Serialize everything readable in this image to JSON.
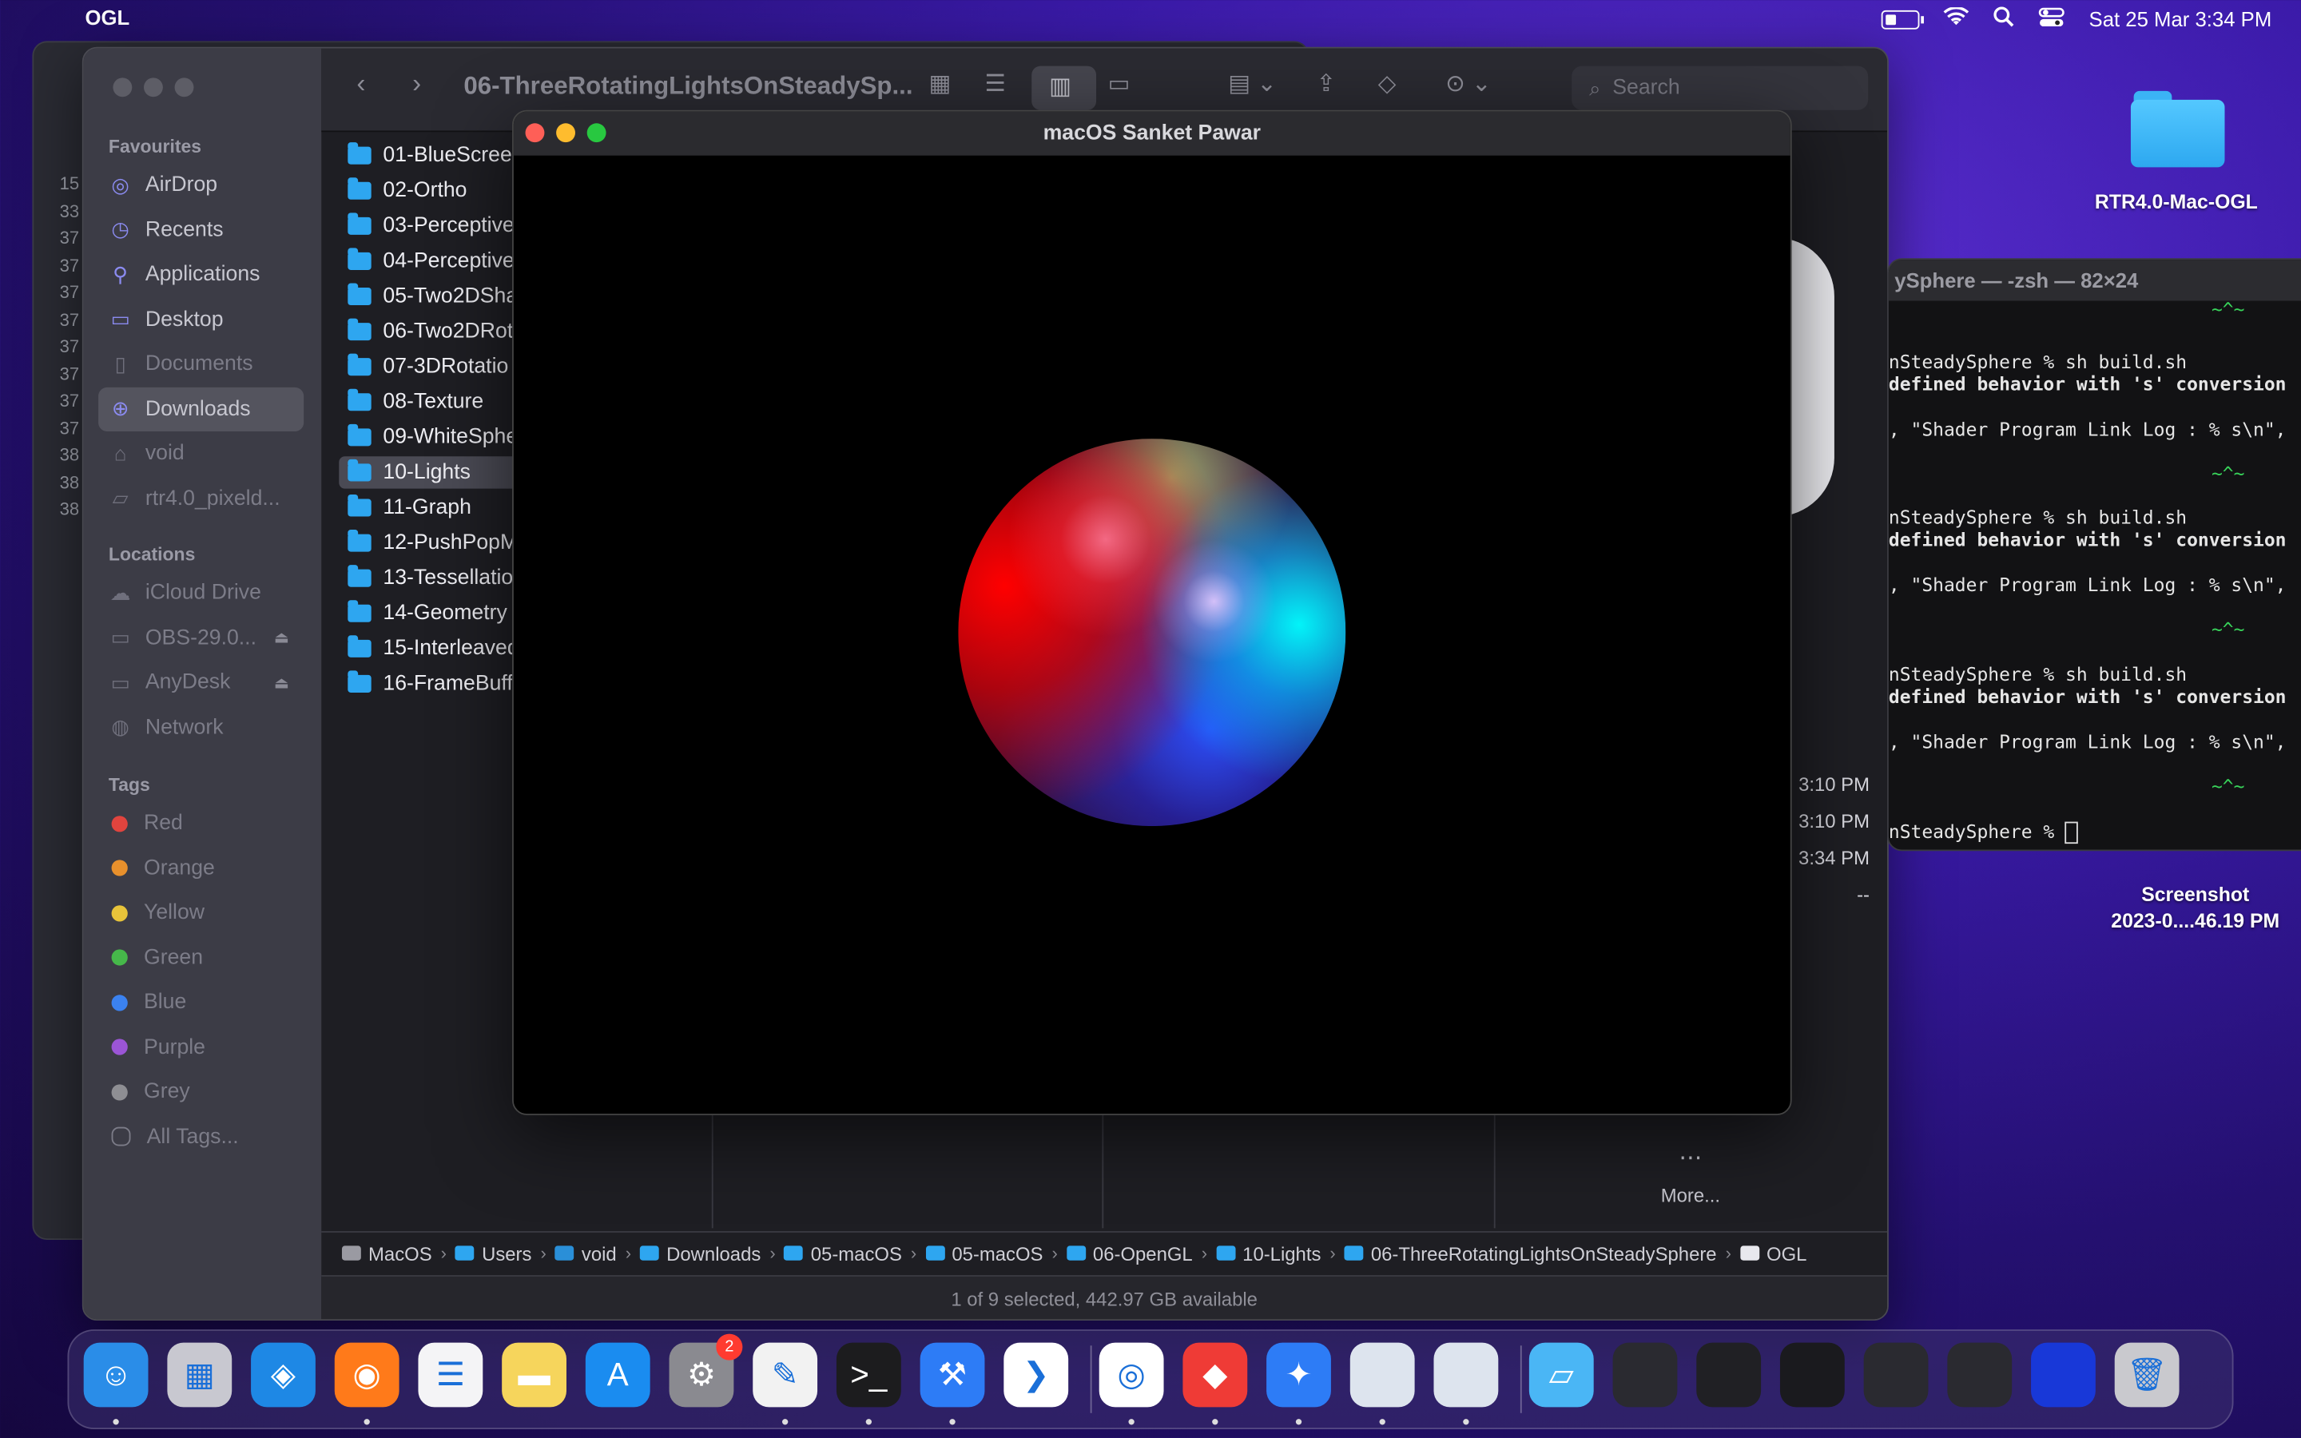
{
  "menubar": {
    "app_name": "OGL",
    "datetime": "Sat 25 Mar  3:34 PM"
  },
  "finder": {
    "title": "06-ThreeRotatingLightsOnSteadySp...",
    "search_placeholder": "Search",
    "sections": {
      "favourites": "Favourites",
      "locations": "Locations",
      "tags": "Tags"
    },
    "favourites": [
      {
        "label": "AirDrop",
        "icon": "airdrop-icon"
      },
      {
        "label": "Recents",
        "icon": "clock-icon"
      },
      {
        "label": "Applications",
        "icon": "applications-icon"
      },
      {
        "label": "Desktop",
        "icon": "desktop-icon"
      },
      {
        "label": "Documents",
        "icon": "document-icon"
      },
      {
        "label": "Downloads",
        "icon": "download-icon"
      },
      {
        "label": "void",
        "icon": "home-icon"
      },
      {
        "label": "rtr4.0_pixeld...",
        "icon": "folder-icon"
      }
    ],
    "locations": [
      {
        "label": "iCloud Drive",
        "icon": "cloud-icon"
      },
      {
        "label": "OBS-29.0...",
        "icon": "disk-icon"
      },
      {
        "label": "AnyDesk",
        "icon": "disk-icon"
      },
      {
        "label": "Network",
        "icon": "network-icon"
      }
    ],
    "tags": [
      {
        "label": "Red",
        "color": "#e0443e"
      },
      {
        "label": "Orange",
        "color": "#e8902c"
      },
      {
        "label": "Yellow",
        "color": "#e8c43a"
      },
      {
        "label": "Green",
        "color": "#46b84a"
      },
      {
        "label": "Blue",
        "color": "#3b82f0"
      },
      {
        "label": "Purple",
        "color": "#9b55d6"
      },
      {
        "label": "Grey",
        "color": "#8e8e93"
      },
      {
        "label": "All Tags...",
        "color": ""
      }
    ],
    "folders": [
      "01-BlueScree",
      "02-Ortho",
      "03-Perceptive",
      "04-Perceptive",
      "05-Two2DSha",
      "06-Two2DRot",
      "07-3DRotatio",
      "08-Texture",
      "09-WhiteSphe",
      "10-Lights",
      "11-Graph",
      "12-PushPopM",
      "13-Tessellatio",
      "14-Geometry",
      "15-Interleaved",
      "16-FrameBuff"
    ],
    "selected_folder": "10-Lights",
    "times": [
      ", 3:10 PM",
      ", 3:10 PM",
      "3:34 PM",
      "--"
    ],
    "more_label": "More...",
    "path": [
      "MacOS",
      "Users",
      "void",
      "Downloads",
      "05-macOS",
      "05-macOS",
      "06-OpenGL",
      "10-Lights",
      "06-ThreeRotatingLightsOnSteadySphere",
      "OGL"
    ],
    "status": "1 of 9 selected, 442.97 GB available"
  },
  "gl_window": {
    "title": "macOS Sanket Pawar"
  },
  "terminal": {
    "title": "ySphere — -zsh — 82×24",
    "lines": [
      {
        "text": "~^~",
        "style": "g"
      },
      {
        "text": "nSteadySphere % sh build.sh",
        "style": ""
      },
      {
        "text": "defined behavior with 's' conversion",
        "style": "b"
      },
      {
        "text": ", \"Shader Program Link Log : % s\\n\",",
        "style": ""
      },
      {
        "text": "~^~",
        "style": "g"
      },
      {
        "text": "nSteadySphere % sh build.sh",
        "style": ""
      },
      {
        "text": "defined behavior with 's' conversion",
        "style": "b"
      },
      {
        "text": ", \"Shader Program Link Log : % s\\n\",",
        "style": ""
      },
      {
        "text": "~^~",
        "style": "g"
      },
      {
        "text": "nSteadySphere % sh build.sh",
        "style": ""
      },
      {
        "text": "defined behavior with 's' conversion",
        "style": "b"
      },
      {
        "text": ", \"Shader Program Link Log : % s\\n\",",
        "style": ""
      },
      {
        "text": "~^~",
        "style": "g"
      },
      {
        "text": "nSteadySphere % ",
        "style": ""
      }
    ]
  },
  "desktop": {
    "folder_label": "RTR4.0-Mac-OGL",
    "screenshot_label_1": "Screenshot",
    "screenshot_label_2": "2023-0....46.19 PM"
  },
  "bg_line_numbers": [
    "15",
    "33",
    "37",
    "37",
    "37",
    "37",
    "37",
    "37",
    "37",
    "37",
    "38",
    "38",
    "38"
  ],
  "dock": {
    "apps": [
      {
        "name": "finder",
        "icon": "finder-icon",
        "color": "#2a8de8",
        "running": true
      },
      {
        "name": "launchpad",
        "icon": "launchpad-icon",
        "color": "#c8c8d0",
        "running": false
      },
      {
        "name": "safari",
        "icon": "safari-icon",
        "color": "#1e88e5",
        "running": false
      },
      {
        "name": "firefox",
        "icon": "firefox-icon",
        "color": "#ff7a1a",
        "running": true
      },
      {
        "name": "reminders",
        "icon": "reminders-icon",
        "color": "#f4f4f6",
        "running": false
      },
      {
        "name": "notes",
        "icon": "notes-icon",
        "color": "#f6d55c",
        "running": false
      },
      {
        "name": "app-store",
        "icon": "app-store-icon",
        "color": "#1a8cf0",
        "running": false
      },
      {
        "name": "system-settings",
        "icon": "gear-icon",
        "color": "#8a8a90",
        "running": false,
        "badge": "2"
      },
      {
        "name": "textedit",
        "icon": "textedit-icon",
        "color": "#f2f2f2",
        "running": true
      },
      {
        "name": "terminal",
        "icon": "terminal-icon",
        "color": "#1c1c1e",
        "running": true
      },
      {
        "name": "xcode",
        "icon": "xcode-icon",
        "color": "#2d7cf6",
        "running": true
      },
      {
        "name": "vscode",
        "icon": "vscode-icon",
        "color": "#ffffff",
        "running": false
      },
      {
        "name": "chrome",
        "icon": "chrome-icon",
        "color": "#ffffff",
        "running": true
      },
      {
        "name": "anydesk",
        "icon": "anydesk-icon",
        "color": "#ef3b36",
        "running": true
      },
      {
        "name": "xcode-tools",
        "icon": "instruments-icon",
        "color": "#2d7cf6",
        "running": true
      },
      {
        "name": "ogl-app-1",
        "icon": "blank-app-icon",
        "color": "#dde4ee",
        "running": true
      },
      {
        "name": "ogl-app-2",
        "icon": "blank-app-icon",
        "color": "#dde4ee",
        "running": true
      },
      {
        "name": "downloads-stack",
        "icon": "folder-stack-icon",
        "color": "#4ab6f5",
        "running": false
      },
      {
        "name": "recent-1",
        "icon": "window-thumb-icon",
        "color": "#2a2a30",
        "running": false
      },
      {
        "name": "recent-2",
        "icon": "window-thumb-icon",
        "color": "#202024",
        "running": false
      },
      {
        "name": "recent-3",
        "icon": "window-thumb-icon",
        "color": "#1a1a1e",
        "running": false
      },
      {
        "name": "recent-4",
        "icon": "window-thumb-icon",
        "color": "#2a2a30",
        "running": false
      },
      {
        "name": "recent-5",
        "icon": "window-thumb-icon",
        "color": "#2a2a30",
        "running": false
      },
      {
        "name": "recent-6",
        "icon": "window-thumb-icon",
        "color": "#1838d8",
        "running": false
      },
      {
        "name": "trash",
        "icon": "trash-icon",
        "color": "#c9c9ce",
        "running": false
      }
    ]
  }
}
